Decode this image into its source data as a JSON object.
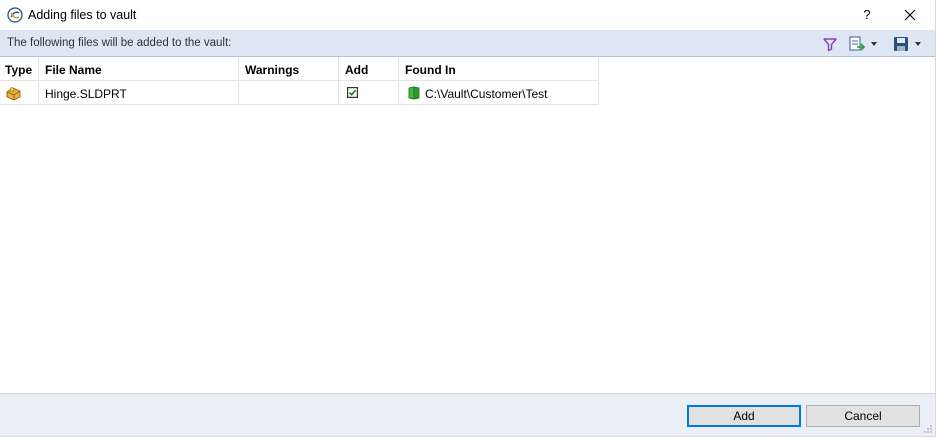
{
  "window": {
    "title": "Adding files to vault",
    "help_label": "?"
  },
  "info": {
    "text": "The following files will be added to the vault:"
  },
  "toolbar_icons": [
    "filter-icon",
    "export-icon",
    "save-icon"
  ],
  "table": {
    "columns": [
      "Type",
      "File Name",
      "Warnings",
      "Add",
      "Found In"
    ],
    "rows": [
      {
        "type_icon": "solidworks-part-icon",
        "file_name": "Hinge.SLDPRT",
        "warnings": "",
        "add_checked": true,
        "found_in": "C:\\Vault\\Customer\\Test"
      }
    ]
  },
  "buttons": {
    "add": "Add",
    "cancel": "Cancel"
  },
  "colors": {
    "info_bar": "#dde6f3",
    "bottom_bar": "#eaeef6",
    "default_button_border": "#0078d7",
    "folder_green": "#2e9c2e",
    "filter_purple": "#8b3fb5"
  }
}
